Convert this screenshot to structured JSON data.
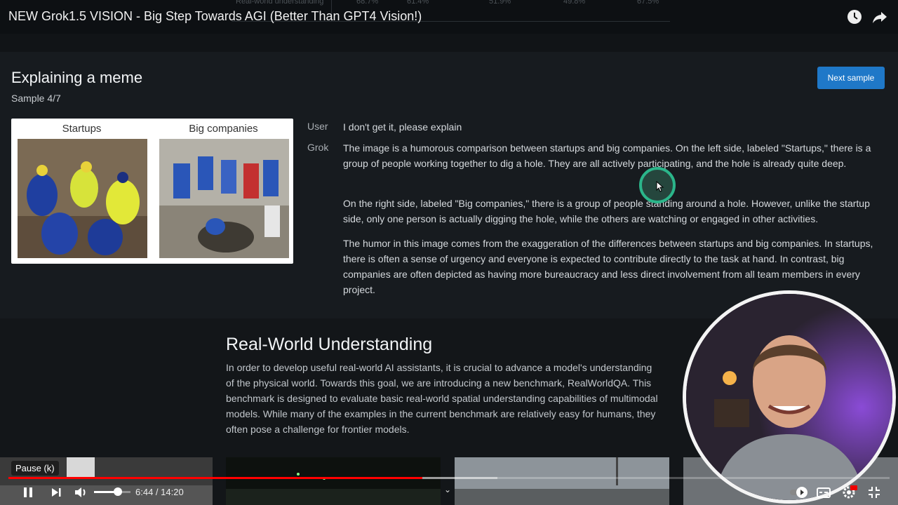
{
  "player": {
    "video_title": "NEW Grok1.5 VISION - Big Step Towards AGI (Better Than GPT4 Vision!)",
    "tooltip": "Pause (k)",
    "time_display": "6:44 / 14:20",
    "progress_fraction": 0.47,
    "volume_fraction": 0.65,
    "accent_color": "#ff0000",
    "icons": [
      "watch-later-icon",
      "share-icon",
      "pause-icon",
      "next-icon",
      "volume-icon",
      "autoplay-toggle-icon",
      "captions-icon",
      "settings-icon",
      "fullscreen-exit-icon"
    ]
  },
  "top_strip": {
    "row_label": "Real-world understanding",
    "values": [
      "68.7%",
      "61.4%",
      "51.9%",
      "49.8%",
      "67.5%"
    ]
  },
  "sample": {
    "heading": "Explaining a meme",
    "counter": "Sample 4/7",
    "next_button": "Next sample",
    "button_color": "#1f78c8",
    "meme": {
      "left_label": "Startups",
      "right_label": "Big companies"
    },
    "user_speaker": "User",
    "user_message": "I don't get it, please explain",
    "grok_speaker": "Grok",
    "grok_paragraphs": [
      "The image is a humorous comparison between startups and big companies. On the left side, labeled \"Startups,\" there is a group of people working together to dig a hole. They are all actively participating, and the hole is already quite deep.",
      "On the right side, labeled \"Big companies,\" there is a group of people standing around a hole. However, unlike the startup side, only one person is actually digging the hole, while the others are watching or engaged in other activities.",
      "The humor in this image comes from the exaggeration of the differences between startups and big companies. In startups, there is often a sense of urgency and everyone is expected to contribute directly to the task at hand. In contrast, big companies are often depicted as having more bureaucracy and less direct involvement from all team members in every project."
    ]
  },
  "real_world": {
    "title": "Real-World Understanding",
    "body": "In order to develop useful real-world AI assistants, it is crucial to advance a model's understanding of the physical world. Towards this goal, we are introducing a new benchmark, RealWorldQA. This benchmark is designed to evaluate basic real-world spatial understanding capabilities of multimodal models. While many of the examples in the current benchmark are relatively easy for humans, they often pose a challenge for frontier models."
  }
}
